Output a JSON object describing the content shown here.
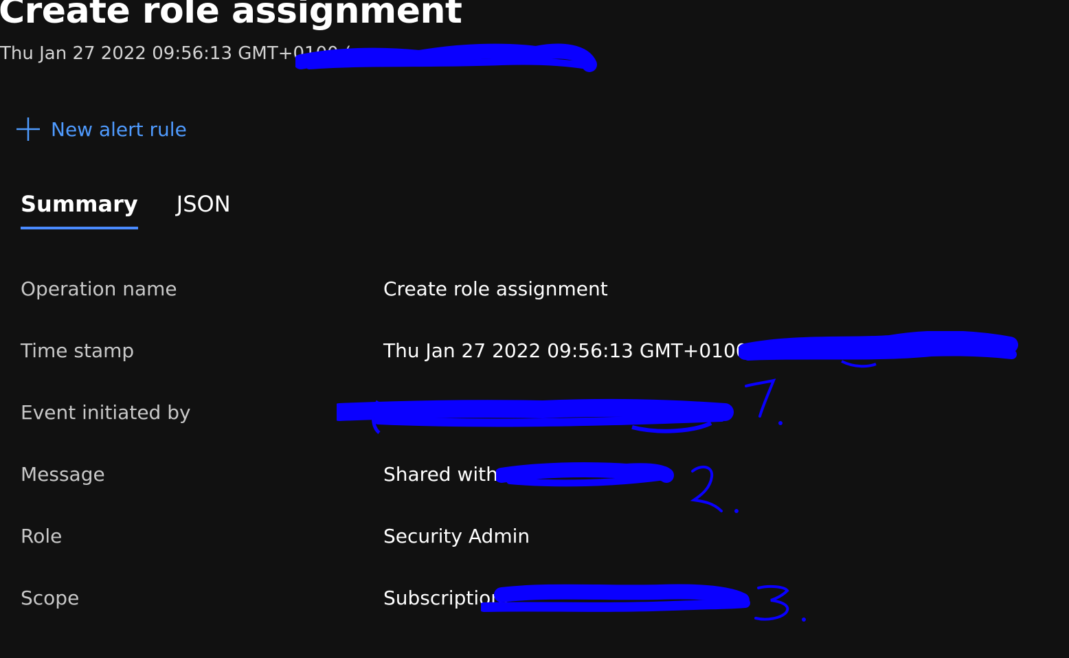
{
  "page": {
    "title": "Create role assignment",
    "subtitle": "Thu Jan 27 2022 09:56:13 GMT+0100 ("
  },
  "toolbar": {
    "new_alert_label": "New alert rule"
  },
  "tabs": [
    {
      "label": "Summary",
      "active": true
    },
    {
      "label": "JSON",
      "active": false
    }
  ],
  "details": [
    {
      "key": "Operation name",
      "value": "Create role assignment"
    },
    {
      "key": "Time stamp",
      "value": "Thu Jan 27 2022 09:56:13 GMT+0100 ("
    },
    {
      "key": "Event initiated by",
      "value": ""
    },
    {
      "key": "Message",
      "value": "Shared with"
    },
    {
      "key": "Role",
      "value": "Security Admin"
    },
    {
      "key": "Scope",
      "value": "Subscription:"
    }
  ],
  "annotations": [
    "1.",
    "2.",
    "3."
  ],
  "colors": {
    "background": "#111111",
    "accent": "#4a8bff",
    "link": "#4f9bff",
    "redaction": "#0a00ff"
  },
  "icons": {
    "new_alert": "plus-icon"
  }
}
